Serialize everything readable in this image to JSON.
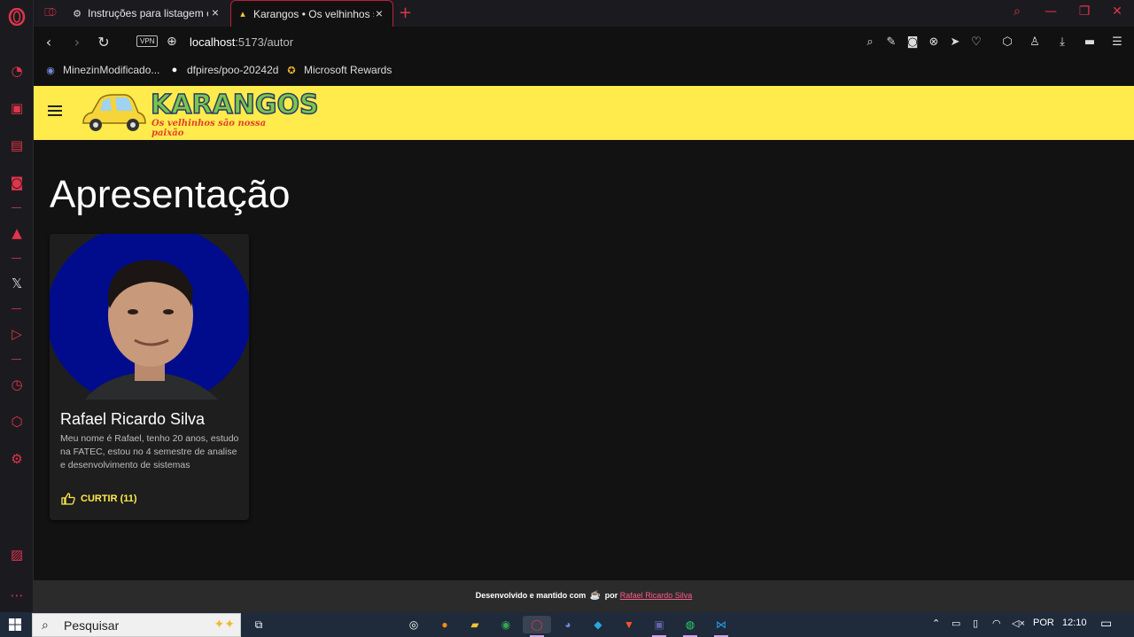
{
  "browser": {
    "tabs": [
      {
        "title": "Instruções para listagem ca",
        "favicon": "gear-icon",
        "active": false
      },
      {
        "title": "Karangos • Os velhinhos sã",
        "favicon": "car-icon",
        "active": true
      }
    ],
    "new_tab": "+",
    "url_host": "localhost",
    "url_path": ":5173/autor",
    "vpn_label": "VPN",
    "bookmarks": [
      {
        "label": "MinezinModificado...",
        "icon": "discord-icon"
      },
      {
        "label": "dfpires/poo-20242d",
        "icon": "github-icon"
      },
      {
        "label": "Microsoft Rewards",
        "icon": "medal-icon"
      }
    ]
  },
  "app": {
    "logo_text": "KARANGOS",
    "logo_tagline": "Os velhinhos são nossa paixão",
    "page_title": "Apresentação",
    "card": {
      "name": "Rafael Ricardo Silva",
      "description": "Meu nome é Rafael, tenho 20 anos, estudo na FATEC, estou no 4 semestre de analise e desenvolvimento de sistemas",
      "like_label": "CURTIR (11)"
    },
    "footer": {
      "text_before": "Desenvolvido e mantido com",
      "text_por": "por",
      "author_link": "Rafael Ricardo Silva"
    },
    "colors": {
      "appbar": "#ffeb4b",
      "background": "#121212",
      "card": "#1e1e1e",
      "accent": "#ffeb4b",
      "link": "#ff5c8d"
    }
  },
  "taskbar": {
    "search_placeholder": "Pesquisar",
    "language": "POR",
    "time": "12:10"
  }
}
